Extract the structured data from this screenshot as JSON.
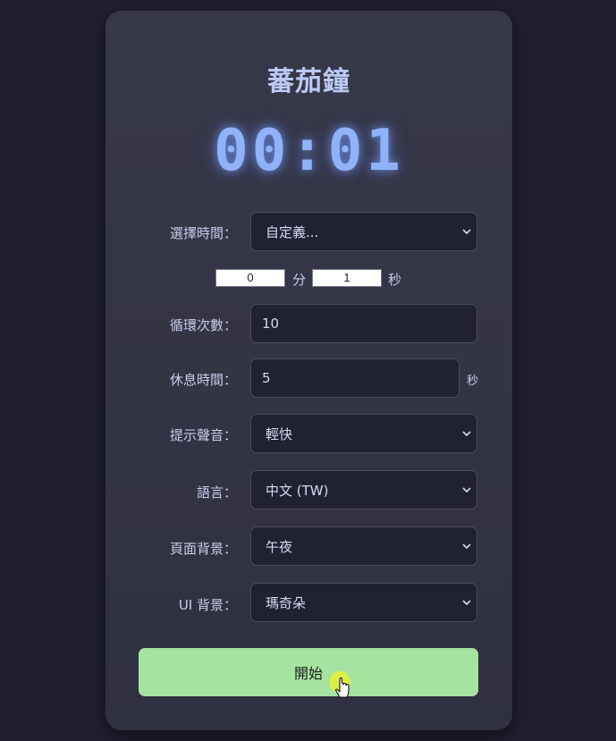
{
  "app": {
    "title": "蕃茄鐘",
    "timer_display": "00:01"
  },
  "time_select": {
    "label": "選擇時間：",
    "value": "自定義..."
  },
  "custom_time": {
    "minutes_value": "0",
    "minutes_unit": "分",
    "seconds_value": "1",
    "seconds_unit": "秒"
  },
  "cycles": {
    "label": "循環次數：",
    "value": "10"
  },
  "rest": {
    "label": "休息時間：",
    "value": "5",
    "unit": "秒"
  },
  "sound": {
    "label": "提示聲音：",
    "value": "輕快"
  },
  "language": {
    "label": "語言：",
    "value": "中文 (TW)"
  },
  "page_bg": {
    "label": "頁面背景：",
    "value": "午夜"
  },
  "ui_bg": {
    "label": "UI 背景：",
    "value": "瑪奇朵"
  },
  "start": {
    "label": "開始"
  },
  "colors": {
    "page_background": "#1f1f2e",
    "card_background": "#373849",
    "timer_glow": "#8fb2f8",
    "start_button": "#a5e3a0"
  },
  "icons": {
    "dropdown": "chevron-down-icon",
    "cursor": "hand-pointer-icon"
  }
}
